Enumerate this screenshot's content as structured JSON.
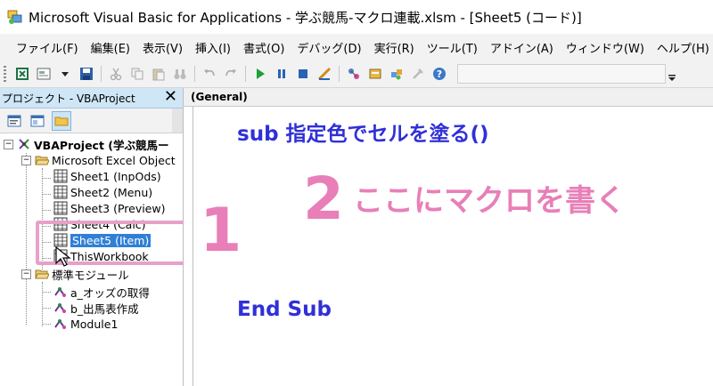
{
  "window": {
    "title": "Microsoft Visual Basic for Applications - 学ぶ競馬-マクロ連載.xlsm - [Sheet5 (コード)]"
  },
  "menu": {
    "items": [
      "ファイル(F)",
      "編集(E)",
      "表示(V)",
      "挿入(I)",
      "書式(O)",
      "デバッグ(D)",
      "実行(R)",
      "ツール(T)",
      "アドイン(A)",
      "ウィンドウ(W)",
      "ヘルプ(H)"
    ]
  },
  "project_pane": {
    "title": "プロジェクト - VBAProject",
    "close_label": "✕",
    "tree": {
      "root": "VBAProject (学ぶ競馬ー",
      "folder_objects": "Microsoft Excel Object",
      "sheets": [
        "Sheet1 (InpOds)",
        "Sheet2 (Menu)",
        "Sheet3 (Preview)",
        "Sheet4 (Calc)",
        "Sheet5 (Item)",
        "ThisWorkbook"
      ],
      "folder_modules": "標準モジュール",
      "modules": [
        "a_オッズの取得",
        "b_出馬表作成",
        "Module1"
      ]
    }
  },
  "code_window": {
    "object_selector": "(General)",
    "line1": "sub  指定色でセルを塗る()",
    "line2": "End Sub"
  },
  "annotations": {
    "num1": "1",
    "num2": "2",
    "text2": "ここにマクロを書く"
  },
  "colors": {
    "annotation": "#e87fb8",
    "code_text": "#3030d8",
    "selection": "#2f7fd6",
    "pane_header": "#cfe6f7"
  }
}
